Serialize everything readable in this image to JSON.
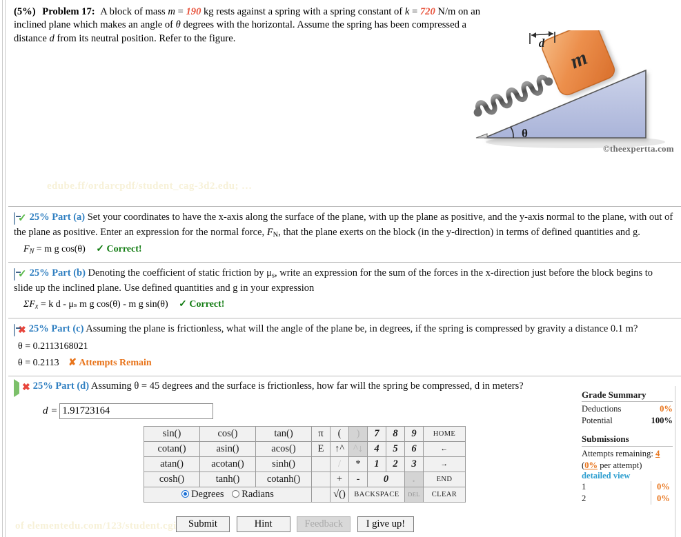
{
  "problem": {
    "percent": "(5%)",
    "label": "Problem 17:",
    "text_1": "A block of mass ",
    "var_m": "m",
    "eq1": " = ",
    "val_m": "190",
    "text_2": " kg rests against a spring with a spring constant of ",
    "var_k": "k",
    "eq2": " = ",
    "val_k": "720",
    "text_3": " N/m on an inclined plane which makes an angle of ",
    "var_theta": "θ",
    "text_4": " degrees with the horizontal. Assume the spring has been compressed a distance ",
    "var_d": "d",
    "text_5": " from its neutral position. Refer to the figure."
  },
  "figure": {
    "block_label": "m",
    "distance_label": "d",
    "angle_label": "θ",
    "credit": "©theexpertta.com",
    "block_color": "#e8843c",
    "plane_color": "#b8c0e0",
    "spring_color": "#5a5a5a"
  },
  "watermarks": {
    "top": "edube.ff/ordarcpdf/student_cag-3d2.edu; …",
    "bottom": "of elementedu.com/123/student.cgi"
  },
  "parts": [
    {
      "id": "a",
      "toggle_icon": "box-minus-icon",
      "status_icon": "green-check-icon",
      "percent": "25%",
      "label": "Part (a)",
      "prompt_a": "Set your coordinates to have the x-axis along the surface of the plane, with up the plane as positive, and the y-axis normal to the plane, with out of the plane as positive. Enter an expression for the normal force, ",
      "prompt_sym": "F",
      "prompt_sub": "N",
      "prompt_b": ", that the plane exerts on the block (in the y-direction) in terms of defined quantities and g.",
      "answer_sym": "F",
      "answer_sub": "N",
      "answer_eq": " = m g cos(θ)",
      "status_text": "✓ Correct!",
      "status_kind": "correct"
    },
    {
      "id": "b",
      "toggle_icon": "box-minus-icon",
      "status_icon": "green-check-icon",
      "percent": "25%",
      "label": "Part (b)",
      "prompt_a": "Denoting the coefficient of static friction by μ",
      "prompt_sub_mu": "s",
      "prompt_b": ", write an expression for the sum of the forces in the x-direction just before the block begins to slide up the inclined plane. Use defined quantities and g in your expression",
      "answer_sym": "ΣF",
      "answer_sub": "x",
      "answer_eq": " = k d - μₛ m g cos(θ) - m g sin(θ)",
      "status_text": "✓ Correct!",
      "status_kind": "correct"
    },
    {
      "id": "c",
      "toggle_icon": "box-minus-icon",
      "status_icon": "red-burst-icon",
      "percent": "25%",
      "label": "Part (c)",
      "prompt_a": "Assuming the plane is frictionless, what will the angle of the plane be, in degrees, if the spring is compressed by gravity a distance 0.1 m?",
      "attempt_1": "θ = 0.2113168021",
      "attempt_2": "θ = 0.2113",
      "status_text": "✘ Attempts Remain",
      "status_kind": "remain"
    }
  ],
  "part_d": {
    "toggle_icon": "play-triangle-icon",
    "status_icon": "red-burst-icon",
    "percent": "25%",
    "label": "Part (d)",
    "prompt": "Assuming θ = 45 degrees and the surface is frictionless, how far will the spring be compressed, d in meters?",
    "input_label": "d =",
    "input_value": "1.91723164",
    "input_placeholder": ""
  },
  "keypad": {
    "functions": [
      [
        "sin()",
        "cos()",
        "tan()"
      ],
      [
        "cotan()",
        "asin()",
        "acos()"
      ],
      [
        "atan()",
        "acotan()",
        "sinh()"
      ],
      [
        "cosh()",
        "tanh()",
        "cotanh()"
      ]
    ],
    "rows": [
      {
        "sym": "π",
        "op1": "(",
        "op2": ")",
        "op2_disabled": true,
        "n": [
          "7",
          "8",
          "9"
        ],
        "nav": "HOME"
      },
      {
        "sym": "E",
        "op1": "↑^",
        "op2": "^↓",
        "op2_disabled": true,
        "n": [
          "4",
          "5",
          "6"
        ],
        "nav": "←"
      },
      {
        "sym": "",
        "op1": "/",
        "op2": "*",
        "op2_disabled": false,
        "n": [
          "1",
          "2",
          "3"
        ],
        "nav": "→"
      }
    ],
    "row4": {
      "sym": "",
      "op1": "+",
      "op2": "-",
      "zero": "0",
      "dot": ".",
      "nav": "END"
    },
    "row5": {
      "sym": "",
      "sqrt": "√()",
      "backspace": "BACKSPACE",
      "del": "DEL",
      "clear": "CLEAR"
    },
    "angle_mode": {
      "selected": "Degrees",
      "options": [
        "Degrees",
        "Radians"
      ]
    }
  },
  "action_buttons": [
    {
      "label": "Submit",
      "disabled": false
    },
    {
      "label": "Hint",
      "disabled": false
    },
    {
      "label": "Feedback",
      "disabled": true
    },
    {
      "label": "I give up!",
      "disabled": false
    }
  ],
  "sidebar": {
    "grade_title": "Grade Summary",
    "deductions_label": "Deductions",
    "deductions_value": "0%",
    "potential_label": "Potential",
    "potential_value": "100%",
    "submissions_title": "Submissions",
    "attempts_label": "Attempts remaining:",
    "attempts_value": "4",
    "per_attempt_pct": "0%",
    "per_attempt_text": " per attempt)",
    "per_attempt_open": "(",
    "detailed_view": "detailed view",
    "history": [
      {
        "n": "1",
        "value": "0%"
      },
      {
        "n": "2",
        "value": "0%"
      }
    ]
  },
  "colors": {
    "accent_blue": "#2f7fc1",
    "orange": "#e8741b",
    "green": "#127c12",
    "red": "#d81e1e",
    "value_red": "#e8533c"
  }
}
